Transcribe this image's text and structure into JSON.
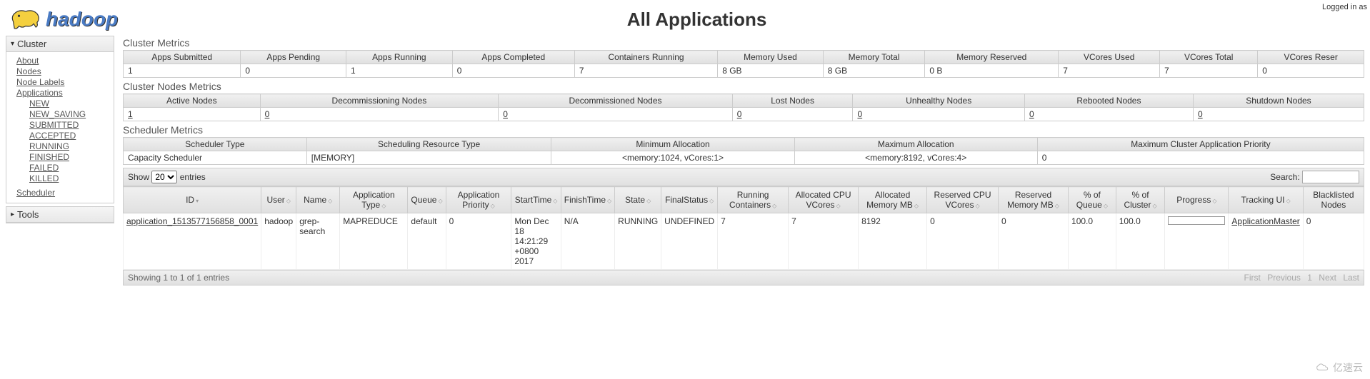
{
  "top_right": "Logged in as",
  "logo_text": "hadoop",
  "page_title": "All Applications",
  "sidebar": {
    "cluster": {
      "label": "Cluster",
      "about": "About",
      "nodes": "Nodes",
      "node_labels": "Node Labels",
      "applications": "Applications",
      "app_states": {
        "new": "NEW",
        "new_saving": "NEW_SAVING",
        "submitted": "SUBMITTED",
        "accepted": "ACCEPTED",
        "running": "RUNNING",
        "finished": "FINISHED",
        "failed": "FAILED",
        "killed": "KILLED"
      },
      "scheduler": "Scheduler"
    },
    "tools": {
      "label": "Tools"
    }
  },
  "cluster_metrics": {
    "title": "Cluster Metrics",
    "headers": {
      "apps_submitted": "Apps Submitted",
      "apps_pending": "Apps Pending",
      "apps_running": "Apps Running",
      "apps_completed": "Apps Completed",
      "containers_running": "Containers Running",
      "memory_used": "Memory Used",
      "memory_total": "Memory Total",
      "memory_reserved": "Memory Reserved",
      "vcores_used": "VCores Used",
      "vcores_total": "VCores Total",
      "vcores_reserved": "VCores Reser"
    },
    "values": {
      "apps_submitted": "1",
      "apps_pending": "0",
      "apps_running": "1",
      "apps_completed": "0",
      "containers_running": "7",
      "memory_used": "8 GB",
      "memory_total": "8 GB",
      "memory_reserved": "0 B",
      "vcores_used": "7",
      "vcores_total": "7",
      "vcores_reserved": "0"
    }
  },
  "cluster_nodes_metrics": {
    "title": "Cluster Nodes Metrics",
    "headers": {
      "active": "Active Nodes",
      "decommissioning": "Decommissioning Nodes",
      "decommissioned": "Decommissioned Nodes",
      "lost": "Lost Nodes",
      "unhealthy": "Unhealthy Nodes",
      "rebooted": "Rebooted Nodes",
      "shutdown": "Shutdown Nodes"
    },
    "values": {
      "active": "1",
      "decommissioning": "0",
      "decommissioned": "0",
      "lost": "0",
      "unhealthy": "0",
      "rebooted": "0",
      "shutdown": "0"
    }
  },
  "scheduler_metrics": {
    "title": "Scheduler Metrics",
    "headers": {
      "type": "Scheduler Type",
      "resource_type": "Scheduling Resource Type",
      "min_alloc": "Minimum Allocation",
      "max_alloc": "Maximum Allocation",
      "max_priority": "Maximum Cluster Application Priority"
    },
    "values": {
      "type": "Capacity Scheduler",
      "resource_type": "[MEMORY]",
      "min_alloc": "<memory:1024, vCores:1>",
      "max_alloc": "<memory:8192, vCores:4>",
      "max_priority": "0"
    }
  },
  "dt": {
    "show": "Show",
    "entries": "entries",
    "show_value": "20",
    "search": "Search:",
    "info": "Showing 1 to 1 of 1 entries",
    "first": "First",
    "previous": "Previous",
    "page1": "1",
    "next": "Next",
    "last": "Last"
  },
  "apps_table": {
    "headers": {
      "id": "ID",
      "user": "User",
      "name": "Name",
      "type": "Application Type",
      "queue": "Queue",
      "priority": "Application Priority",
      "start": "StartTime",
      "finish": "FinishTime",
      "state": "State",
      "final_status": "FinalStatus",
      "running_containers": "Running Containers",
      "alloc_vcores": "Allocated CPU VCores",
      "alloc_mem": "Allocated Memory MB",
      "reserved_vcores": "Reserved CPU VCores",
      "reserved_mem": "Reserved Memory MB",
      "pct_queue": "% of Queue",
      "pct_cluster": "% of Cluster",
      "progress": "Progress",
      "tracking_ui": "Tracking UI",
      "blacklisted": "Blacklisted Nodes"
    },
    "row": {
      "id": "application_1513577156858_0001",
      "user": "hadoop",
      "name": "grep-search",
      "type": "MAPREDUCE",
      "queue": "default",
      "priority": "0",
      "start": "Mon Dec 18 14:21:29 +0800 2017",
      "finish": "N/A",
      "state": "RUNNING",
      "final_status": "UNDEFINED",
      "running_containers": "7",
      "alloc_vcores": "7",
      "alloc_mem": "8192",
      "reserved_vcores": "0",
      "reserved_mem": "0",
      "pct_queue": "100.0",
      "pct_cluster": "100.0",
      "tracking_ui": "ApplicationMaster",
      "blacklisted": "0"
    }
  },
  "watermark": "亿速云"
}
